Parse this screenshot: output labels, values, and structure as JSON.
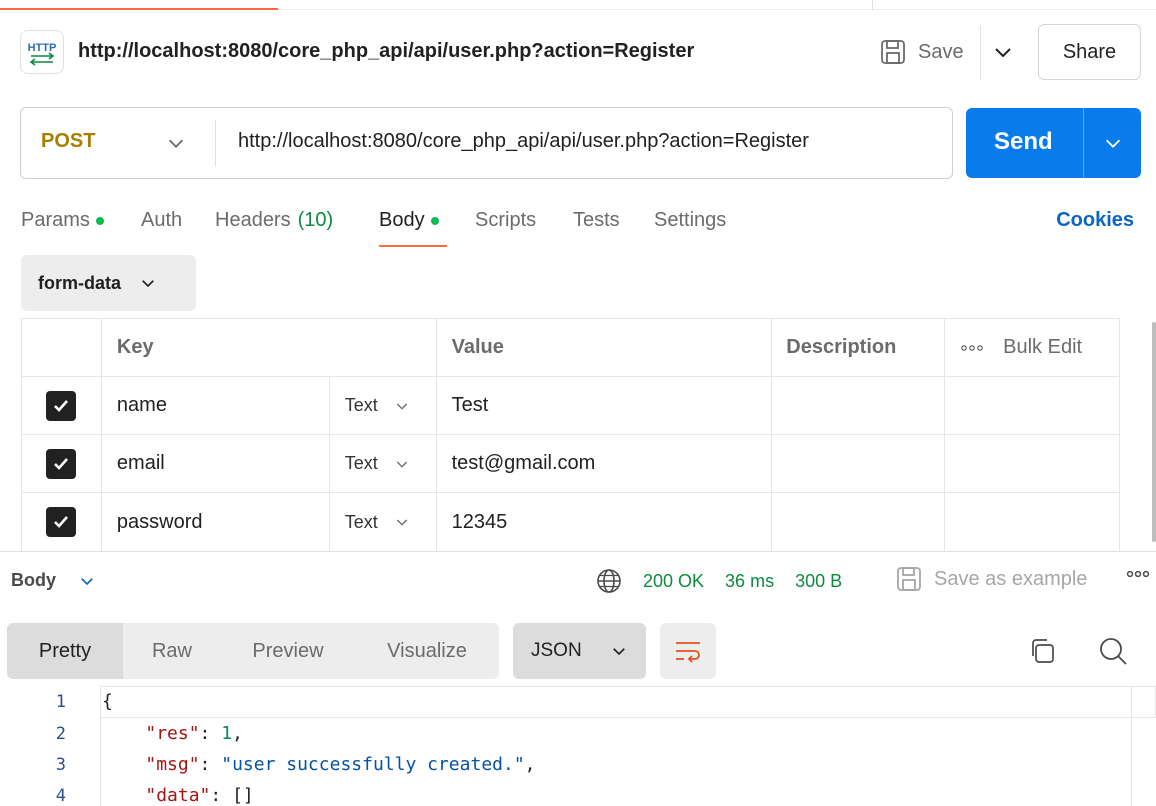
{
  "header": {
    "title": "http://localhost:8080/core_php_api/api/user.php?action=Register",
    "http_icon_label": "HTTP",
    "save_label": "Save",
    "share_label": "Share"
  },
  "request": {
    "method": "POST",
    "url": "http://localhost:8080/core_php_api/api/user.php?action=Register",
    "send_label": "Send",
    "method_color": "#a87e00"
  },
  "tabs": {
    "params": "Params",
    "auth": "Auth",
    "headers": "Headers",
    "headers_count": "(10)",
    "body": "Body",
    "scripts": "Scripts",
    "tests": "Tests",
    "settings": "Settings",
    "cookies": "Cookies"
  },
  "body_type": "form-data",
  "table": {
    "headers": {
      "key": "Key",
      "value": "Value",
      "description": "Description",
      "bulk_edit": "Bulk Edit"
    },
    "rows": [
      {
        "key": "name",
        "type": "Text",
        "value": "Test",
        "checked": true
      },
      {
        "key": "email",
        "type": "Text",
        "value": "test@gmail.com",
        "checked": true
      },
      {
        "key": "password",
        "type": "Text",
        "value": "12345",
        "checked": true
      }
    ]
  },
  "response": {
    "body_label": "Body",
    "status": "200 OK",
    "time": "36 ms",
    "size": "300 B",
    "save_example": "Save as example",
    "views": [
      "Pretty",
      "Raw",
      "Preview",
      "Visualize"
    ],
    "format": "JSON",
    "lines": [
      "1",
      "2",
      "3",
      "4"
    ],
    "code": {
      "open": "{",
      "res_key": "\"res\"",
      "res_val": "1",
      "msg_key": "\"msg\"",
      "msg_val": "\"user successfully created.\"",
      "data_key": "\"data\"",
      "data_val": "[]"
    }
  },
  "colors": {
    "accent": "#ff6c37",
    "send": "#097bed",
    "status_ok": "#0c8a3e",
    "link": "#0b66c2"
  }
}
